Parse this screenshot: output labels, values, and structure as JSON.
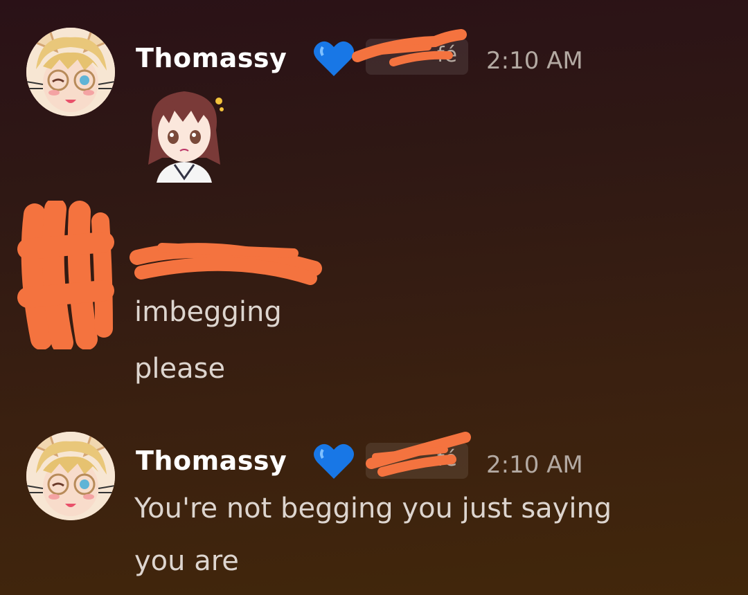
{
  "messages": [
    {
      "author": "Thomassy",
      "badge": "💙",
      "tag_visible_text": "fé",
      "time": "2:10 AM",
      "sticker": "anime-girl-sticker"
    },
    {
      "author": "",
      "lines": [
        "imbegging",
        "please"
      ]
    },
    {
      "author": "Thomassy",
      "badge": "💙",
      "tag_visible_text": "fé",
      "time": "2:10 AM",
      "lines": [
        "You're not begging you just saying",
        "you are"
      ]
    }
  ],
  "colors": {
    "redaction": "#f4733f",
    "username": "#ffffff",
    "timestamp": "#b3a9a2",
    "body_text": "#ddd5cf",
    "heart": "#1877e6"
  }
}
